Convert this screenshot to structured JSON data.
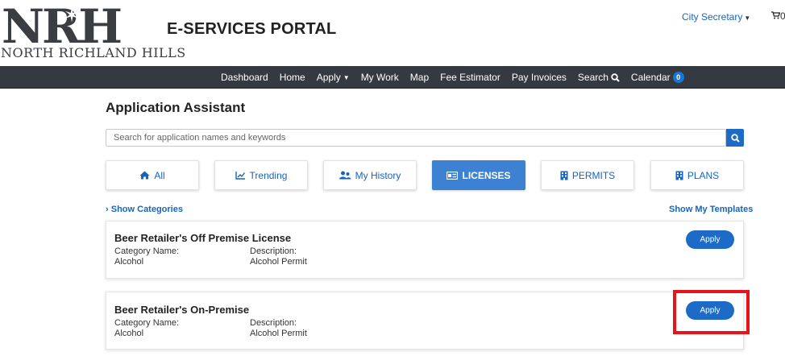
{
  "header": {
    "logo_letters": "NRH",
    "logo_subtitle": "NORTH RICHLAND HILLS",
    "portal_title": "E-SERVICES PORTAL",
    "user_menu": "City Secretary",
    "cart_count": "0"
  },
  "nav": {
    "items": [
      {
        "label": "Dashboard"
      },
      {
        "label": "Home"
      },
      {
        "label": "Apply"
      },
      {
        "label": "My Work"
      },
      {
        "label": "Map"
      },
      {
        "label": "Fee Estimator"
      },
      {
        "label": "Pay Invoices"
      },
      {
        "label": "Search"
      },
      {
        "label": "Calendar"
      }
    ],
    "calendar_badge": "0"
  },
  "main": {
    "title": "Application Assistant",
    "search": {
      "placeholder": "Search for application names and keywords",
      "value": ""
    },
    "tabs": [
      {
        "label": "All",
        "icon": "home-icon"
      },
      {
        "label": "Trending",
        "icon": "line-chart-icon"
      },
      {
        "label": "My History",
        "icon": "users-icon"
      },
      {
        "label": "LICENSES",
        "icon": "id-card-icon",
        "active": true
      },
      {
        "label": "PERMITS",
        "icon": "building-icon"
      },
      {
        "label": "PLANS",
        "icon": "building-icon"
      }
    ],
    "show_categories": "Show Categories",
    "show_templates": "Show My Templates",
    "cards": [
      {
        "title": "Beer Retailer's Off Premise License",
        "category_label": "Category Name:",
        "category_value": "Alcohol",
        "description_label": "Description:",
        "description_value": "Alcohol Permit",
        "apply_label": "Apply"
      },
      {
        "title": "Beer Retailer's On-Premise",
        "category_label": "Category Name:",
        "category_value": "Alcohol",
        "description_label": "Description:",
        "description_value": "Alcohol Permit",
        "apply_label": "Apply"
      }
    ]
  },
  "colors": {
    "accent": "#1e6bc7",
    "active_tab": "#3d82d2",
    "navbar": "#343a40",
    "highlight": "#e8141c"
  }
}
